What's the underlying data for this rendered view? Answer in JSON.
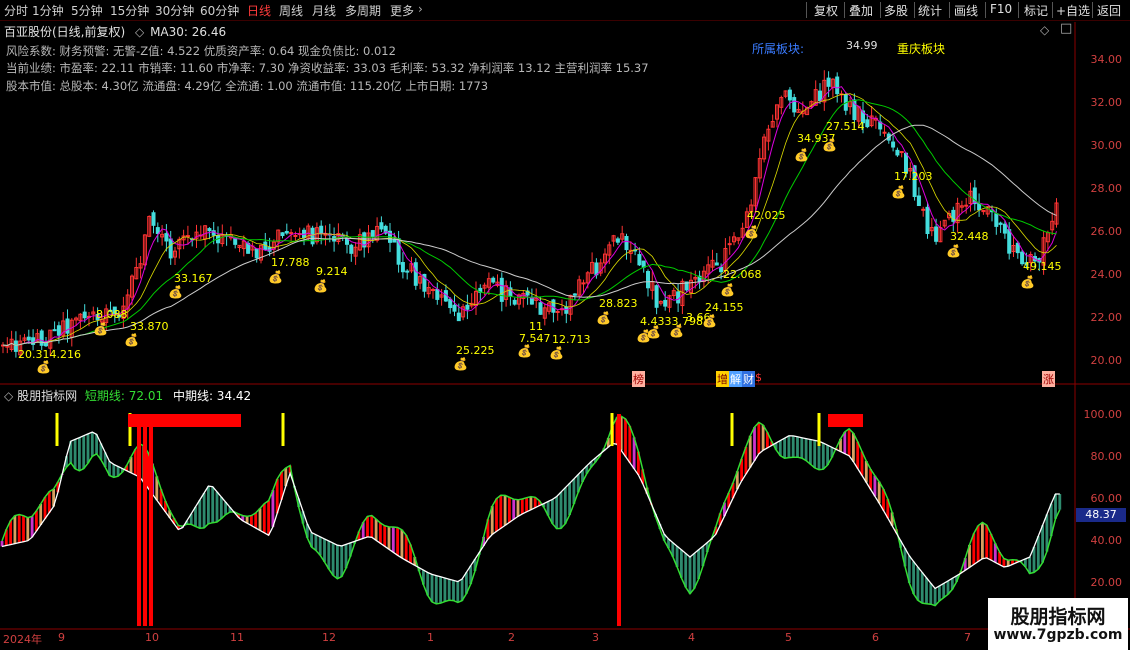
{
  "toolbar": {
    "periods": [
      {
        "label": "分时",
        "active": false
      },
      {
        "label": "1分钟",
        "active": false
      },
      {
        "label": "5分钟",
        "active": false
      },
      {
        "label": "15分钟",
        "active": false
      },
      {
        "label": "30分钟",
        "active": false
      },
      {
        "label": "60分钟",
        "active": false
      },
      {
        "label": "日线",
        "active": true
      },
      {
        "label": "周线",
        "active": false
      },
      {
        "label": "月线",
        "active": false
      },
      {
        "label": "多周期",
        "active": false
      },
      {
        "label": "更多",
        "active": false
      }
    ],
    "right_buttons": [
      "复权",
      "叠加",
      "多股",
      "统计",
      "画线",
      "F10",
      "标记",
      "+自选",
      "返回"
    ]
  },
  "main_chart": {
    "stock_title": "百亚股份(日线,前复权)",
    "indicator": "MA30: 26.46",
    "info_lines": [
      "风险系数: 财务预警: 无警-Z值: 4.522 优质资产率: 0.64 现金负债比: 0.012",
      "当前业绩: 市盈率: 22.11 市销率: 11.60 市净率: 7.30 净资收益率: 33.03 毛利率: 53.32 净利润率 13.12 主营利润率 15.37",
      "股本市值: 总股本: 4.30亿 流通盘: 4.29亿 全流通: 1.00 流通市值: 115.20亿 上市日期: 1773"
    ],
    "sector_label": "所属板块:",
    "region_label": "重庆板块",
    "high_label": "34.99",
    "y_axis": [
      "34.00",
      "32.00",
      "30.00",
      "28.00",
      "26.00",
      "24.00",
      "22.00",
      "20.00"
    ],
    "annotations": [
      "20.314.216",
      "8.088",
      "33.870",
      "33.167",
      "17.788",
      "9.214",
      "25.225",
      "7.547",
      "11",
      "12.713",
      "28.823",
      "4.4333.798",
      "3.66",
      "24.155",
      "22.068",
      "42.025",
      "34.937",
      "27.514",
      "17.203",
      "32.448",
      "49.145"
    ],
    "event_markers": [
      "榜",
      "增",
      "解",
      "财",
      "$",
      "涨"
    ],
    "colors": {
      "up": "#ff3333",
      "down": "#44dddd",
      "ma_white": "#cccccc",
      "ma_green": "#00cc00",
      "ma_magenta": "#dd00dd",
      "ma_yellow": "#dddd00",
      "bag": "#d9a400"
    }
  },
  "indicator_panel": {
    "name": "股朋指标网",
    "short_label": "短期线: 72.01",
    "mid_label": "中期线: 34.42",
    "y_axis": [
      "100.00",
      "80.00",
      "60.00",
      "40.00",
      "20.00"
    ],
    "current_value": "48.37",
    "colors": {
      "green_line": "#33dd33",
      "white_line": "#ffffff",
      "red_bar": "#ff0000",
      "yellow_tick": "#ffff00",
      "teal_bar": "#2e8b6e",
      "gold_bar": "#d9a060",
      "magenta_bar": "#cc33cc"
    }
  },
  "time_axis": [
    "2024年",
    "9",
    "10",
    "11",
    "12",
    "1",
    "2",
    "3",
    "4",
    "5",
    "6",
    "7"
  ],
  "watermark": {
    "line1": "股朋指标网",
    "line2": "www.7gpzb.com"
  }
}
